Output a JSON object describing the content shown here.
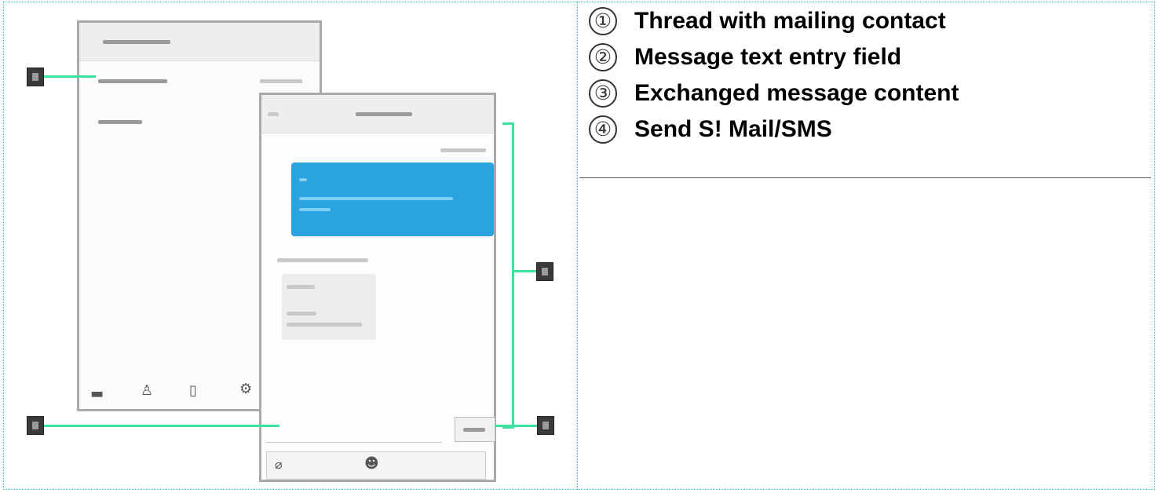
{
  "legend": {
    "items": [
      {
        "number": "①",
        "label": "Thread with mailing contact"
      },
      {
        "number": "②",
        "label": "Message text entry field"
      },
      {
        "number": "③",
        "label": "Exchanged message content"
      },
      {
        "number": "④",
        "label": "Send S! Mail/SMS"
      }
    ]
  },
  "colors": {
    "frame": "#33c8c8",
    "callout_line": "#3ee0a0",
    "bubble": "#2aa3e0"
  },
  "icons": [
    "camera-icon",
    "person-icon",
    "document-icon",
    "gear-icon",
    "attach-icon"
  ]
}
